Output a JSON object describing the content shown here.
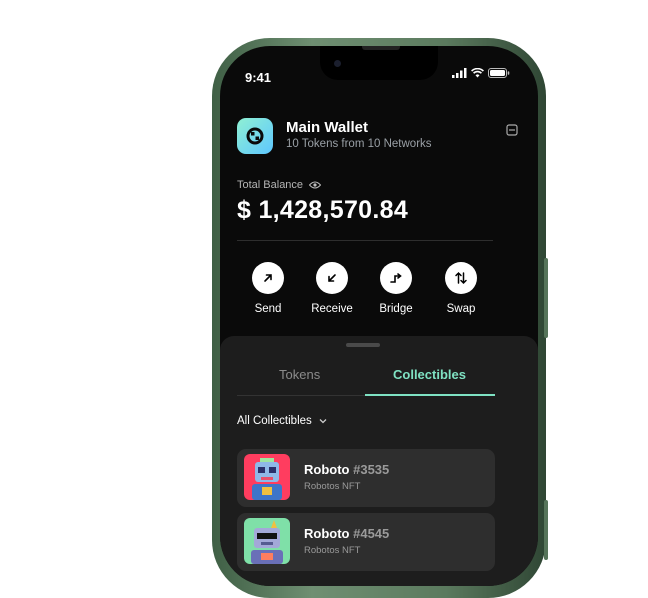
{
  "status_bar": {
    "time": "9:41"
  },
  "wallet": {
    "name": "Main Wallet",
    "subtitle": "10 Tokens from 10 Networks",
    "balance_label": "Total Balance",
    "balance": "$ 1,428,570.84"
  },
  "actions": [
    {
      "label": "Send",
      "icon": "arrow-up-right-icon"
    },
    {
      "label": "Receive",
      "icon": "arrow-down-left-icon"
    },
    {
      "label": "Bridge",
      "icon": "bridge-icon"
    },
    {
      "label": "Swap",
      "icon": "swap-icon"
    }
  ],
  "tabs": [
    {
      "label": "Tokens",
      "active": false
    },
    {
      "label": "Collectibles",
      "active": true
    }
  ],
  "filter": {
    "label": "All Collectibles"
  },
  "collectibles": [
    {
      "name": "Roboto",
      "number": "#3535",
      "collection": "Robotos NFT",
      "bg": "#ff3d5f"
    },
    {
      "name": "Roboto",
      "number": "#4545",
      "collection": "Robotos NFT",
      "bg": "#7fe0a8"
    }
  ],
  "colors": {
    "accent": "#7fe2c3",
    "frame": "#4d6b52",
    "screen": "#0a0a0a",
    "sheet": "#1d1d1d"
  }
}
